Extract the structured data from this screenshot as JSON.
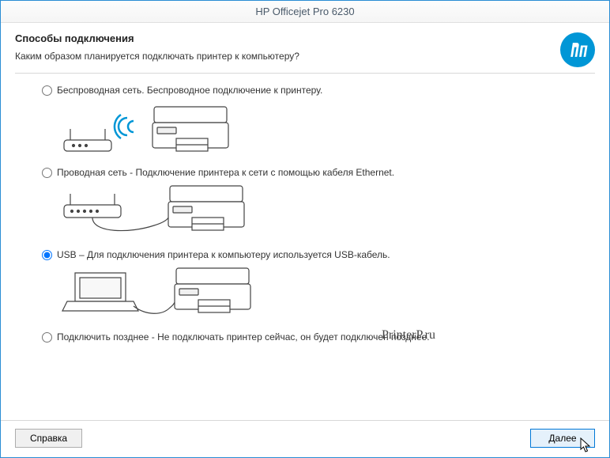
{
  "window": {
    "title": "HP Officejet Pro 6230"
  },
  "header": {
    "heading": "Способы подключения",
    "subheading": "Каким образом планируется подключать принтер к компьютеру?"
  },
  "options": {
    "wireless": {
      "label": "Беспроводная сеть. Беспроводное подключение к принтеру.",
      "selected": false
    },
    "wired": {
      "label": "Проводная сеть - Подключение принтера к сети с помощью кабеля Ethernet.",
      "selected": false
    },
    "usb": {
      "label": "USB – Для подключения принтера к компьютеру используется USB-кабель.",
      "selected": true
    },
    "later": {
      "label": "Подключить позднее - Не подключать принтер сейчас, он будет подключен  позднее.",
      "selected": false
    }
  },
  "footer": {
    "help_label": "Справка",
    "next_label": "Далее"
  },
  "watermark": "PrinterP.ru"
}
